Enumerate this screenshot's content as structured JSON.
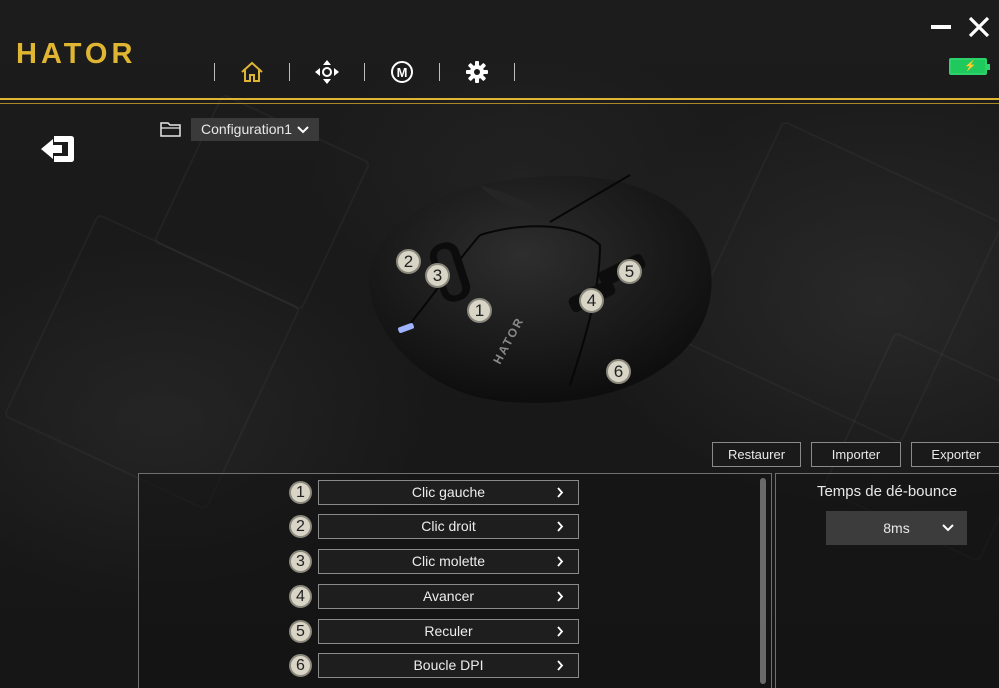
{
  "app": {
    "logo_text": "HATOR",
    "accent_color": "#e0b531"
  },
  "nav": {
    "tabs": [
      {
        "icon": "home-icon",
        "active": true
      },
      {
        "icon": "dpi-move-icon"
      },
      {
        "icon": "macro-icon",
        "glyph": "M"
      },
      {
        "icon": "gear-icon"
      }
    ]
  },
  "window": {
    "minimize_icon": "minimize-icon",
    "close_icon": "close-icon"
  },
  "battery": {
    "icon": "battery-charging-icon",
    "color": "#2bd36a"
  },
  "config": {
    "selected": "Configuration1"
  },
  "callouts": [
    "1",
    "2",
    "3",
    "4",
    "5",
    "6"
  ],
  "actions": {
    "restore": "Restaurer",
    "import": "Importer",
    "export": "Exporter"
  },
  "button_rows": [
    {
      "num": "1",
      "label": "Clic gauche"
    },
    {
      "num": "2",
      "label": "Clic droit"
    },
    {
      "num": "3",
      "label": "Clic molette"
    },
    {
      "num": "4",
      "label": "Avancer"
    },
    {
      "num": "5",
      "label": "Reculer"
    },
    {
      "num": "6",
      "label": "Boucle DPI"
    }
  ],
  "debounce": {
    "label": "Temps de dé-bounce",
    "value": "8ms"
  }
}
